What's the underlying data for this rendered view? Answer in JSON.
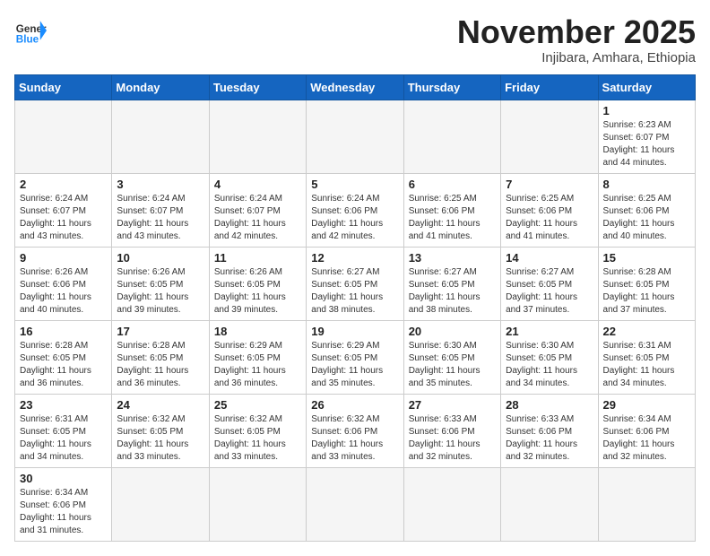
{
  "header": {
    "logo_general": "General",
    "logo_blue": "Blue",
    "month_title": "November 2025",
    "subtitle": "Injibara, Amhara, Ethiopia"
  },
  "weekdays": [
    "Sunday",
    "Monday",
    "Tuesday",
    "Wednesday",
    "Thursday",
    "Friday",
    "Saturday"
  ],
  "weeks": [
    [
      {
        "day": "",
        "info": ""
      },
      {
        "day": "",
        "info": ""
      },
      {
        "day": "",
        "info": ""
      },
      {
        "day": "",
        "info": ""
      },
      {
        "day": "",
        "info": ""
      },
      {
        "day": "",
        "info": ""
      },
      {
        "day": "1",
        "info": "Sunrise: 6:23 AM\nSunset: 6:07 PM\nDaylight: 11 hours and 44 minutes."
      }
    ],
    [
      {
        "day": "2",
        "info": "Sunrise: 6:24 AM\nSunset: 6:07 PM\nDaylight: 11 hours and 43 minutes."
      },
      {
        "day": "3",
        "info": "Sunrise: 6:24 AM\nSunset: 6:07 PM\nDaylight: 11 hours and 43 minutes."
      },
      {
        "day": "4",
        "info": "Sunrise: 6:24 AM\nSunset: 6:07 PM\nDaylight: 11 hours and 42 minutes."
      },
      {
        "day": "5",
        "info": "Sunrise: 6:24 AM\nSunset: 6:06 PM\nDaylight: 11 hours and 42 minutes."
      },
      {
        "day": "6",
        "info": "Sunrise: 6:25 AM\nSunset: 6:06 PM\nDaylight: 11 hours and 41 minutes."
      },
      {
        "day": "7",
        "info": "Sunrise: 6:25 AM\nSunset: 6:06 PM\nDaylight: 11 hours and 41 minutes."
      },
      {
        "day": "8",
        "info": "Sunrise: 6:25 AM\nSunset: 6:06 PM\nDaylight: 11 hours and 40 minutes."
      }
    ],
    [
      {
        "day": "9",
        "info": "Sunrise: 6:26 AM\nSunset: 6:06 PM\nDaylight: 11 hours and 40 minutes."
      },
      {
        "day": "10",
        "info": "Sunrise: 6:26 AM\nSunset: 6:05 PM\nDaylight: 11 hours and 39 minutes."
      },
      {
        "day": "11",
        "info": "Sunrise: 6:26 AM\nSunset: 6:05 PM\nDaylight: 11 hours and 39 minutes."
      },
      {
        "day": "12",
        "info": "Sunrise: 6:27 AM\nSunset: 6:05 PM\nDaylight: 11 hours and 38 minutes."
      },
      {
        "day": "13",
        "info": "Sunrise: 6:27 AM\nSunset: 6:05 PM\nDaylight: 11 hours and 38 minutes."
      },
      {
        "day": "14",
        "info": "Sunrise: 6:27 AM\nSunset: 6:05 PM\nDaylight: 11 hours and 37 minutes."
      },
      {
        "day": "15",
        "info": "Sunrise: 6:28 AM\nSunset: 6:05 PM\nDaylight: 11 hours and 37 minutes."
      }
    ],
    [
      {
        "day": "16",
        "info": "Sunrise: 6:28 AM\nSunset: 6:05 PM\nDaylight: 11 hours and 36 minutes."
      },
      {
        "day": "17",
        "info": "Sunrise: 6:28 AM\nSunset: 6:05 PM\nDaylight: 11 hours and 36 minutes."
      },
      {
        "day": "18",
        "info": "Sunrise: 6:29 AM\nSunset: 6:05 PM\nDaylight: 11 hours and 36 minutes."
      },
      {
        "day": "19",
        "info": "Sunrise: 6:29 AM\nSunset: 6:05 PM\nDaylight: 11 hours and 35 minutes."
      },
      {
        "day": "20",
        "info": "Sunrise: 6:30 AM\nSunset: 6:05 PM\nDaylight: 11 hours and 35 minutes."
      },
      {
        "day": "21",
        "info": "Sunrise: 6:30 AM\nSunset: 6:05 PM\nDaylight: 11 hours and 34 minutes."
      },
      {
        "day": "22",
        "info": "Sunrise: 6:31 AM\nSunset: 6:05 PM\nDaylight: 11 hours and 34 minutes."
      }
    ],
    [
      {
        "day": "23",
        "info": "Sunrise: 6:31 AM\nSunset: 6:05 PM\nDaylight: 11 hours and 34 minutes."
      },
      {
        "day": "24",
        "info": "Sunrise: 6:32 AM\nSunset: 6:05 PM\nDaylight: 11 hours and 33 minutes."
      },
      {
        "day": "25",
        "info": "Sunrise: 6:32 AM\nSunset: 6:05 PM\nDaylight: 11 hours and 33 minutes."
      },
      {
        "day": "26",
        "info": "Sunrise: 6:32 AM\nSunset: 6:06 PM\nDaylight: 11 hours and 33 minutes."
      },
      {
        "day": "27",
        "info": "Sunrise: 6:33 AM\nSunset: 6:06 PM\nDaylight: 11 hours and 32 minutes."
      },
      {
        "day": "28",
        "info": "Sunrise: 6:33 AM\nSunset: 6:06 PM\nDaylight: 11 hours and 32 minutes."
      },
      {
        "day": "29",
        "info": "Sunrise: 6:34 AM\nSunset: 6:06 PM\nDaylight: 11 hours and 32 minutes."
      }
    ],
    [
      {
        "day": "30",
        "info": "Sunrise: 6:34 AM\nSunset: 6:06 PM\nDaylight: 11 hours and 31 minutes."
      },
      {
        "day": "",
        "info": ""
      },
      {
        "day": "",
        "info": ""
      },
      {
        "day": "",
        "info": ""
      },
      {
        "day": "",
        "info": ""
      },
      {
        "day": "",
        "info": ""
      },
      {
        "day": "",
        "info": ""
      }
    ]
  ]
}
